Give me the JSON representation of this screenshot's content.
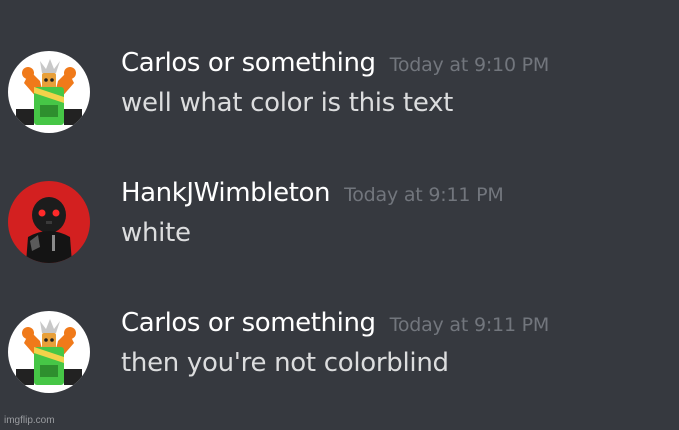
{
  "messages": [
    {
      "author": "Carlos or something",
      "timestamp": "Today at 9:10 PM",
      "text": "well what color is this text",
      "avatar_icon": "orange-robot-avatar"
    },
    {
      "author": "HankJWimbleton",
      "timestamp": "Today at 9:11 PM",
      "text": "white",
      "avatar_icon": "red-eyed-hooded-figure-avatar"
    },
    {
      "author": "Carlos or something",
      "timestamp": "Today at 9:11 PM",
      "text": "then you're not colorblind",
      "avatar_icon": "orange-robot-avatar"
    }
  ],
  "watermark": "imgflip.com",
  "colors": {
    "background": "#36393f",
    "username": "#ffffff",
    "timestamp": "#72767d",
    "message_text": "#dcddde"
  }
}
